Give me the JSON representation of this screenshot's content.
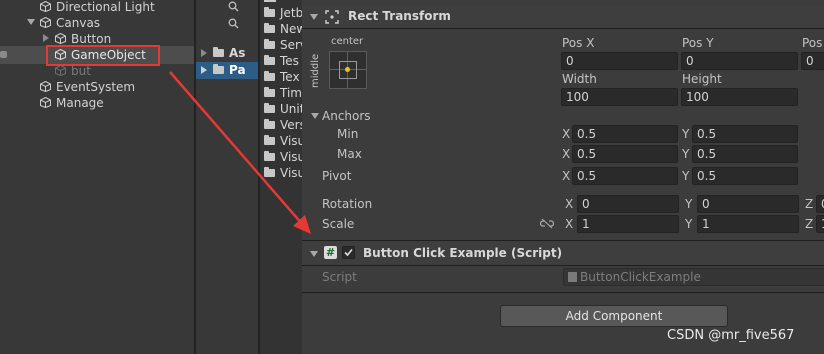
{
  "hierarchy": {
    "items": [
      {
        "label": "Directional Light"
      },
      {
        "label": "Canvas"
      },
      {
        "label": "Button"
      },
      {
        "label": "GameObject"
      },
      {
        "label": "but"
      },
      {
        "label": "EventSystem"
      },
      {
        "label": "Manage"
      }
    ]
  },
  "project": {
    "folders": [
      {
        "label": "As"
      },
      {
        "label": "Pa"
      }
    ],
    "files": [
      {
        "label": "Jetb"
      },
      {
        "label": "New"
      },
      {
        "label": "Serv"
      },
      {
        "label": "Tes"
      },
      {
        "label": "Tex"
      },
      {
        "label": "Tim"
      },
      {
        "label": "Unit"
      },
      {
        "label": "Vers"
      },
      {
        "label": "Visu"
      },
      {
        "label": "Visu"
      },
      {
        "label": "Visu"
      }
    ]
  },
  "inspector": {
    "rect_transform": {
      "title": "Rect Transform",
      "anchor_preset_h": "center",
      "anchor_preset_v": "middle",
      "pos_x_label": "Pos X",
      "pos_y_label": "Pos Y",
      "pos_z_label": "Pos",
      "pos_x": "0",
      "pos_y": "0",
      "pos_z": "0",
      "width_label": "Width",
      "height_label": "Height",
      "width": "100",
      "height": "100",
      "anchors_label": "Anchors",
      "min_label": "Min",
      "max_label": "Max",
      "min_x": "0.5",
      "min_y": "0.5",
      "max_x": "0.5",
      "max_y": "0.5",
      "pivot_label": "Pivot",
      "pivot_x": "0.5",
      "pivot_y": "0.5",
      "rotation_label": "Rotation",
      "rot_x": "0",
      "rot_y": "0",
      "rot_z": "0",
      "scale_label": "Scale",
      "scale_x": "1",
      "scale_y": "1",
      "scale_z": "1",
      "axis_x": "X",
      "axis_y": "Y",
      "axis_z": "Z"
    },
    "script_component": {
      "title": "Button Click Example (Script)",
      "script_label": "Script",
      "script_value": "ButtonClickExample"
    },
    "add_component_label": "Add Component"
  },
  "watermark": "CSDN @mr_five567",
  "colors": {
    "annotation_red": "#e53935",
    "selection_blue": "#2c5d87"
  }
}
